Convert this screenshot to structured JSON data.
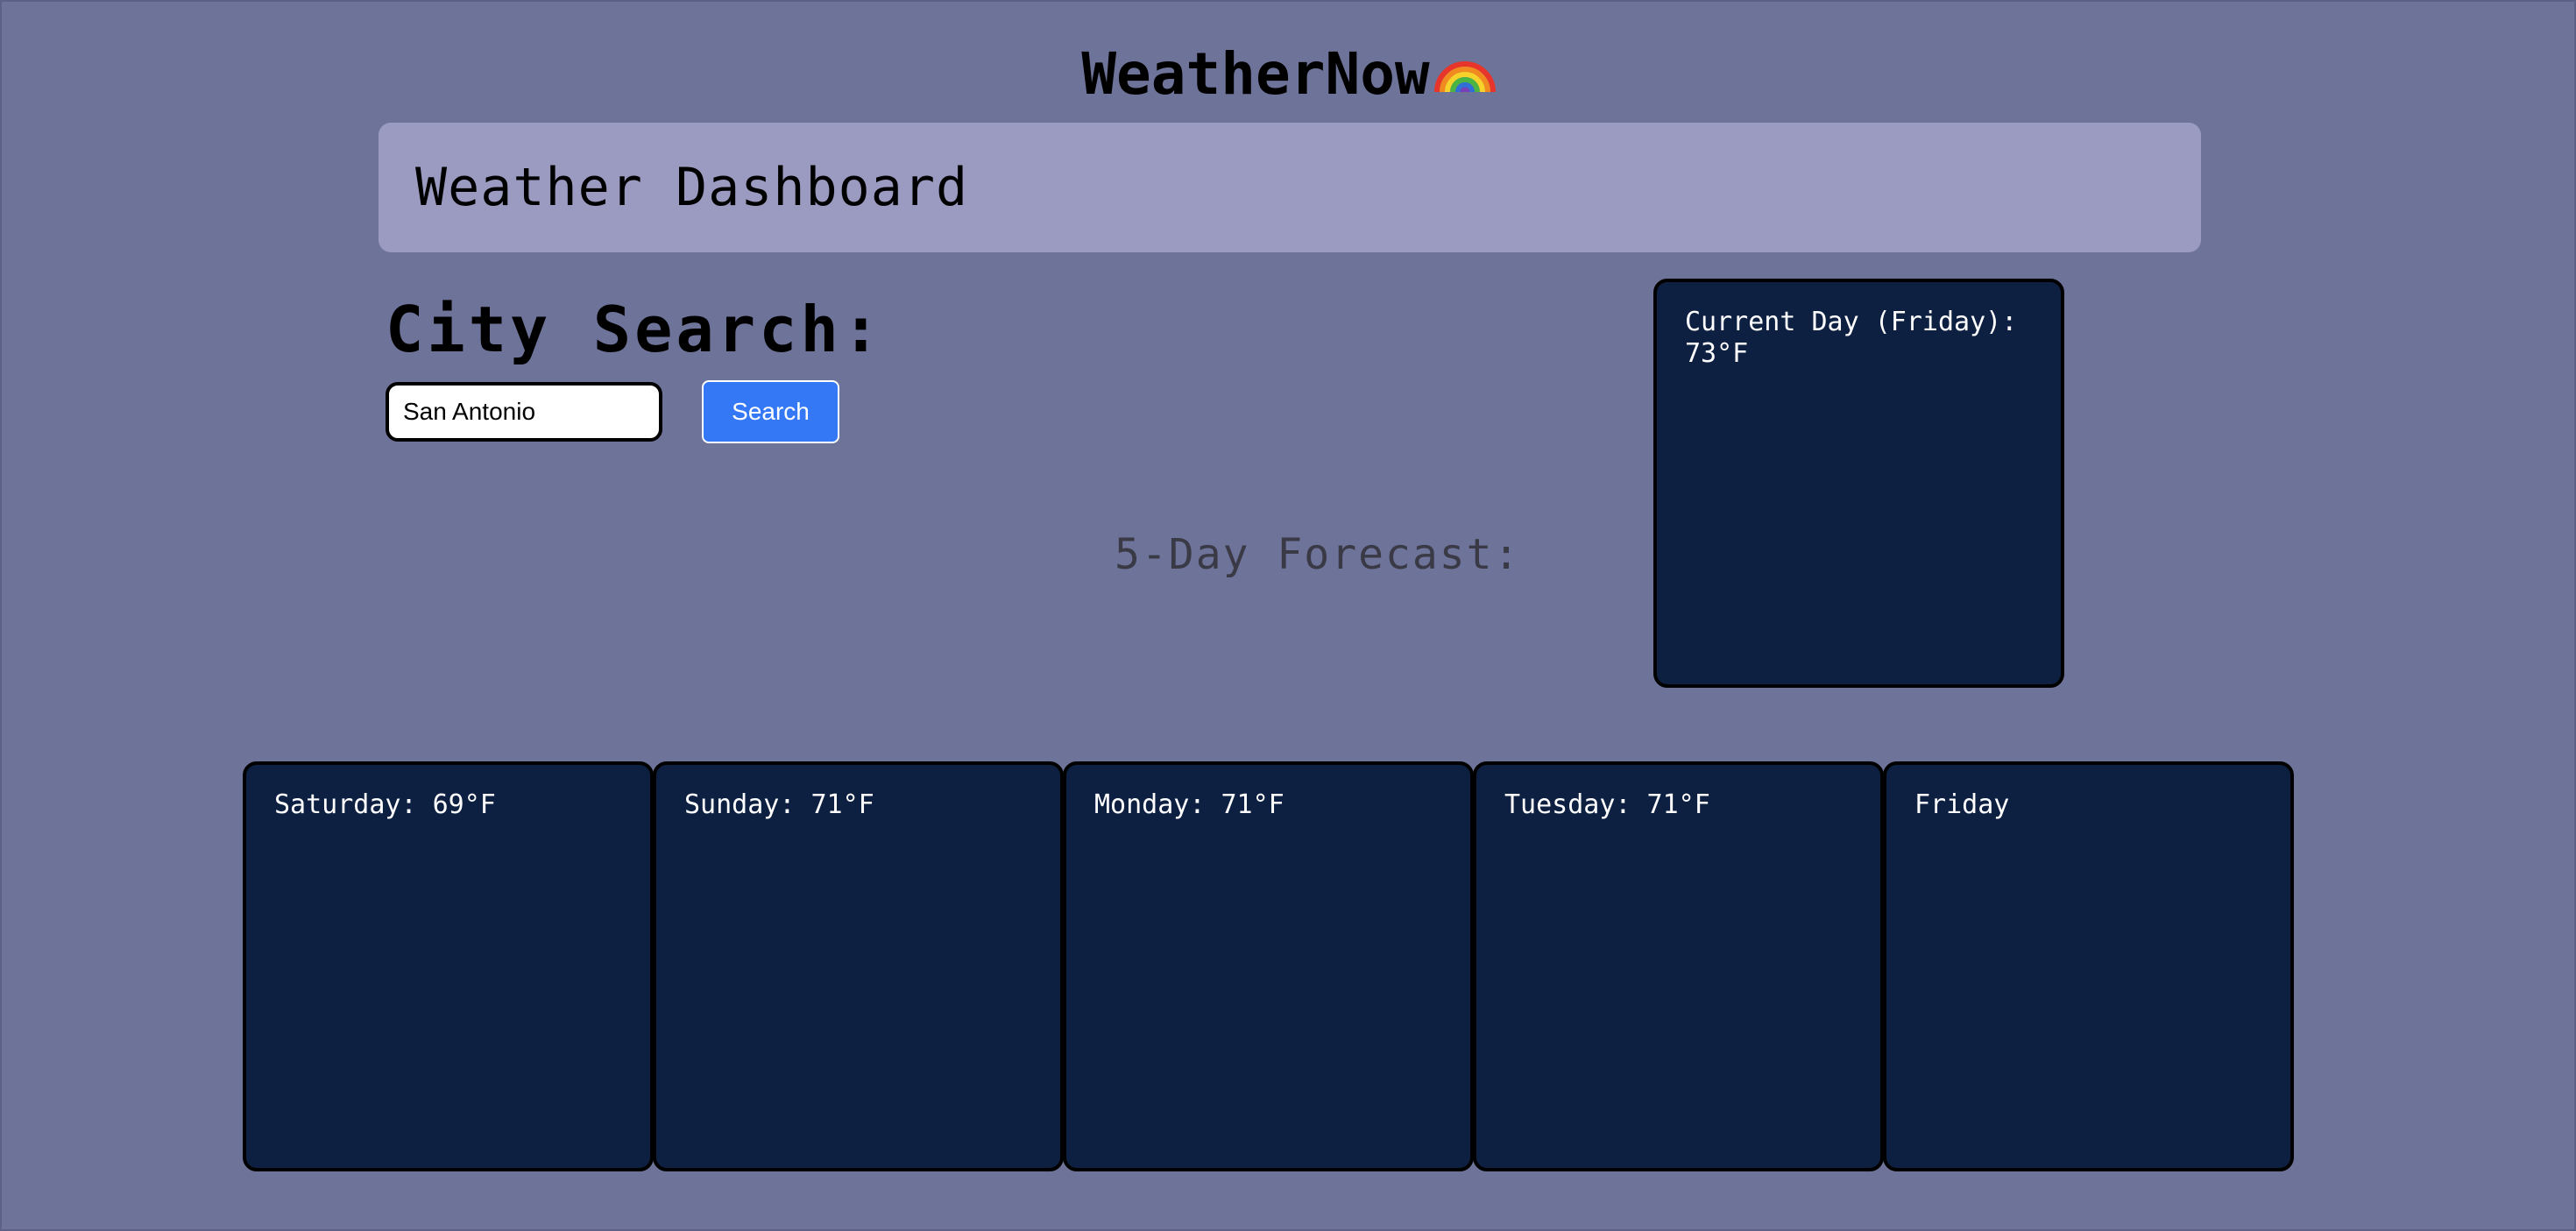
{
  "app_title": "WeatherNow",
  "banner": {
    "title": "Weather Dashboard"
  },
  "search": {
    "heading": "City Search:",
    "input_value": "San Antonio",
    "button_label": "Search"
  },
  "current_day": {
    "label": "Current Day (Friday):",
    "temp": "73°F"
  },
  "forecast": {
    "heading": "5-Day Forecast:",
    "days": [
      {
        "text": "Saturday: 69°F"
      },
      {
        "text": "Sunday: 71°F"
      },
      {
        "text": "Monday: 71°F"
      },
      {
        "text": "Tuesday: 71°F"
      },
      {
        "text": "Friday"
      }
    ]
  },
  "colors": {
    "background": "#6e7399",
    "banner": "#9b9bc2",
    "card": "#0e2041",
    "button": "#3478f6"
  }
}
